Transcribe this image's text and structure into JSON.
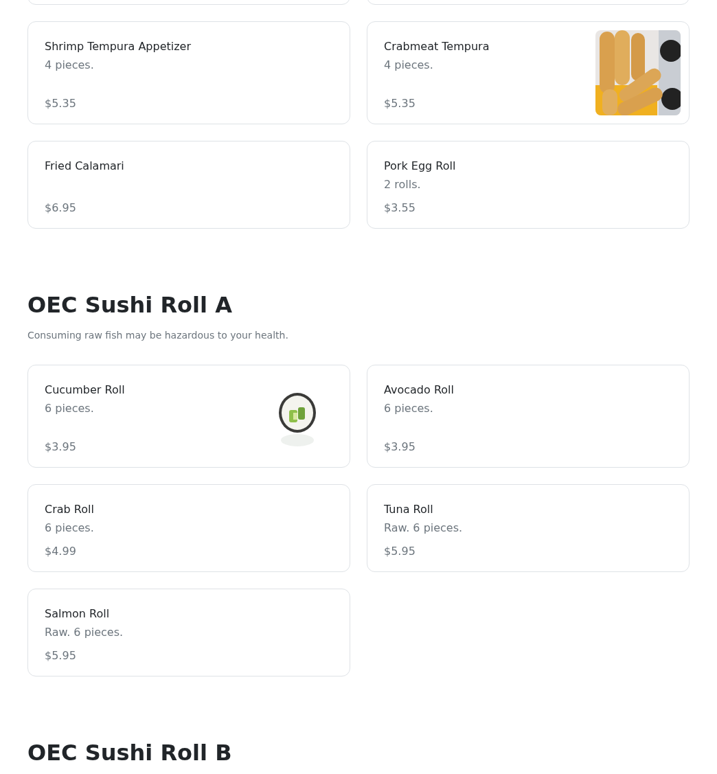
{
  "sections": [
    {
      "items": [
        {
          "name": "Shrimp Tempura Appetizer",
          "description": "4 pieces.",
          "price": "$5.35"
        },
        {
          "name": "Crabmeat Tempura",
          "description": "4 pieces.",
          "price": "$5.35"
        },
        {
          "name": "Fried Calamari",
          "price": "$6.95"
        },
        {
          "name": "Pork Egg Roll",
          "description": "2 rolls.",
          "price": "$3.55"
        }
      ]
    },
    {
      "title": "OEC Sushi Roll A",
      "note": "Consuming raw fish may be hazardous to your health.",
      "items": [
        {
          "name": "Cucumber Roll",
          "description": "6 pieces.",
          "price": "$3.95"
        },
        {
          "name": "Avocado Roll",
          "description": "6 pieces.",
          "price": "$3.95"
        },
        {
          "name": "Crab Roll",
          "description": "6 pieces.",
          "price": "$4.99"
        },
        {
          "name": "Tuna Roll",
          "description": "Raw. 6 pieces.",
          "price": "$5.95"
        },
        {
          "name": "Salmon Roll",
          "description": "Raw. 6 pieces.",
          "price": "$5.95"
        }
      ]
    },
    {
      "title": "OEC Sushi Roll B"
    }
  ]
}
